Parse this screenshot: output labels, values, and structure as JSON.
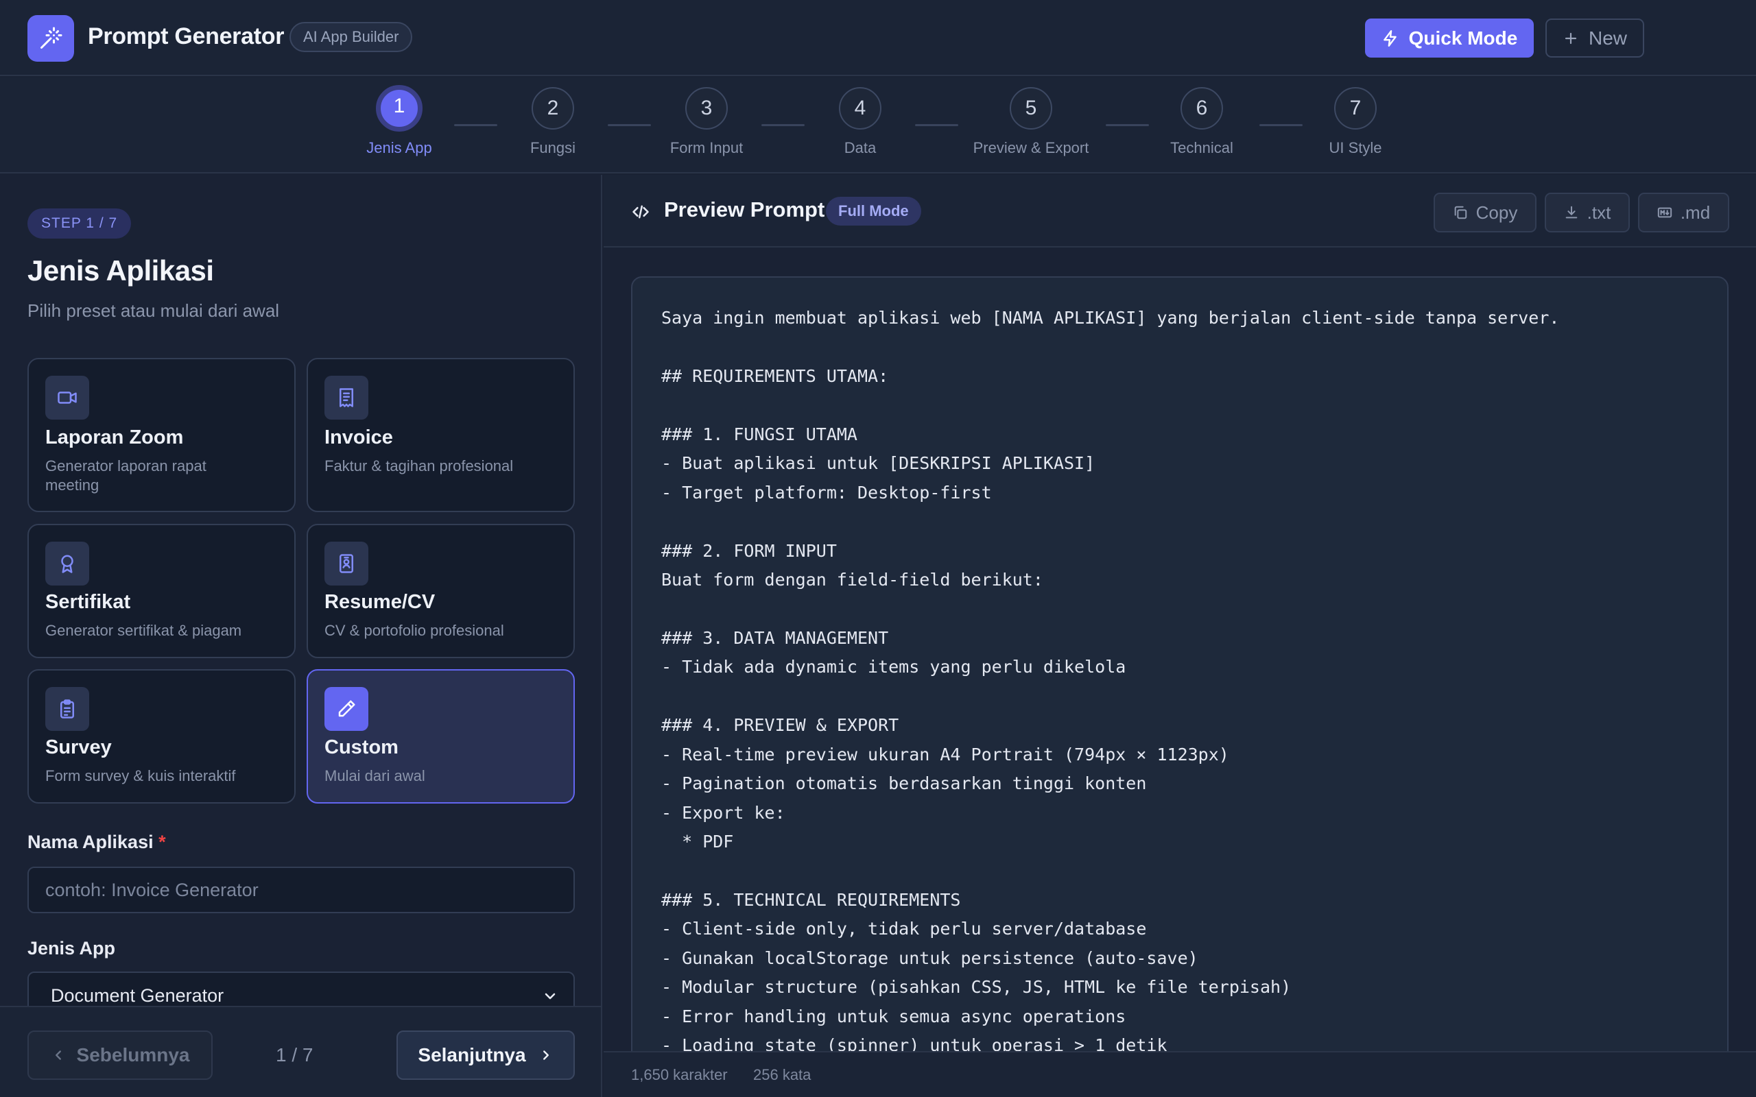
{
  "header": {
    "app_title": "Prompt Generator",
    "badge": "AI App Builder",
    "quick_mode_label": "Quick Mode",
    "new_label": "New"
  },
  "stepper": {
    "active": 1,
    "steps": [
      {
        "number": "1",
        "label": "Jenis App"
      },
      {
        "number": "2",
        "label": "Fungsi"
      },
      {
        "number": "3",
        "label": "Form Input"
      },
      {
        "number": "4",
        "label": "Data"
      },
      {
        "number": "5",
        "label": "Preview & Export"
      },
      {
        "number": "6",
        "label": "Technical"
      },
      {
        "number": "7",
        "label": "UI Style"
      }
    ]
  },
  "left": {
    "step_pill": "STEP 1 / 7",
    "title": "Jenis Aplikasi",
    "subtitle": "Pilih preset atau mulai dari awal",
    "presets": [
      {
        "title": "Laporan Zoom",
        "desc": "Generator laporan rapat meeting",
        "icon": "video-icon",
        "selected": false
      },
      {
        "title": "Invoice",
        "desc": "Faktur & tagihan profesional",
        "icon": "receipt-icon",
        "selected": false
      },
      {
        "title": "Sertifikat",
        "desc": "Generator sertifikat & piagam",
        "icon": "award-icon",
        "selected": false
      },
      {
        "title": "Resume/CV",
        "desc": "CV & portofolio profesional",
        "icon": "id-badge-icon",
        "selected": false
      },
      {
        "title": "Survey",
        "desc": "Form survey & kuis interaktif",
        "icon": "clipboard-icon",
        "selected": false
      },
      {
        "title": "Custom",
        "desc": "Mulai dari awal",
        "icon": "pencil-icon",
        "selected": true
      }
    ],
    "app_name_label": "Nama Aplikasi",
    "required_mark": "*",
    "app_name_value": "",
    "app_name_placeholder": "contoh: Invoice Generator",
    "app_type_label": "Jenis App",
    "app_type_value": "Document Generator",
    "prev_label": "Sebelumnya",
    "page_indicator": "1 / 7",
    "next_label": "Selanjutnya"
  },
  "preview": {
    "title": "Preview Prompt",
    "mode_badge": "Full Mode",
    "copy_label": "Copy",
    "txt_label": ".txt",
    "md_label": ".md",
    "lines": [
      "Saya ingin membuat aplikasi web [NAMA APLIKASI] yang berjalan client-side tanpa server.",
      "",
      "## REQUIREMENTS UTAMA:",
      "",
      "### 1. FUNGSI UTAMA",
      "- Buat aplikasi untuk [DESKRIPSI APLIKASI]",
      "- Target platform: Desktop-first",
      "",
      "### 2. FORM INPUT",
      "Buat form dengan field-field berikut:",
      "",
      "### 3. DATA MANAGEMENT",
      "- Tidak ada dynamic items yang perlu dikelola",
      "",
      "### 4. PREVIEW & EXPORT",
      "- Real-time preview ukuran A4 Portrait (794px × 1123px)",
      "- Pagination otomatis berdasarkan tinggi konten",
      "- Export ke:",
      "  * PDF",
      "",
      "### 5. TECHNICAL REQUIREMENTS",
      "- Client-side only, tidak perlu server/database",
      "- Gunakan localStorage untuk persistence (auto-save)",
      "- Modular structure (pisahkan CSS, JS, HTML ke file terpisah)",
      "- Error handling untuk semua async operations",
      "- Loading state (spinner) untuk operasi > 1 detik"
    ],
    "char_count": "1,650 karakter",
    "word_count": "256 kata"
  },
  "colors": {
    "accent": "#6366f1",
    "background": "#1a2234",
    "required": "#ef4444"
  }
}
